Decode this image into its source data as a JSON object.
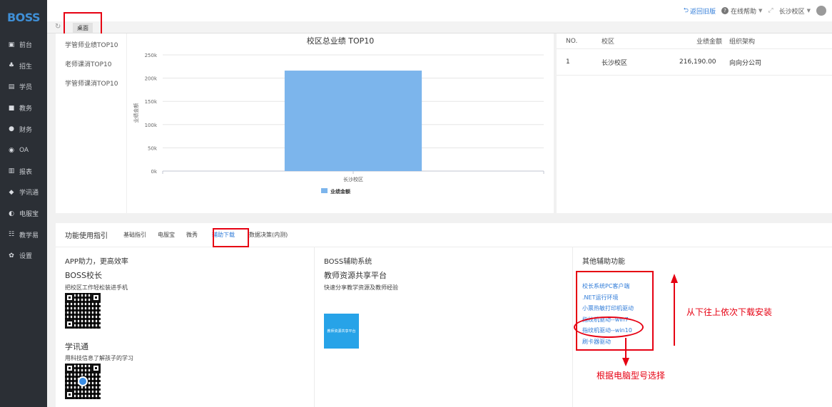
{
  "sidebar": {
    "logo": "BOSS",
    "items": [
      {
        "label": "前台",
        "icon": "calendar-icon"
      },
      {
        "label": "招生",
        "icon": "users-icon"
      },
      {
        "label": "学员",
        "icon": "id-card-icon"
      },
      {
        "label": "教务",
        "icon": "book-icon"
      },
      {
        "label": "财务",
        "icon": "money-icon"
      },
      {
        "label": "OA",
        "icon": "chat-icon"
      },
      {
        "label": "报表",
        "icon": "bar-chart-icon"
      },
      {
        "label": "学讯通",
        "icon": "location-icon"
      },
      {
        "label": "电服宝",
        "icon": "phone-icon"
      },
      {
        "label": "教学易",
        "icon": "teach-icon"
      },
      {
        "label": "设置",
        "icon": "gear-icon"
      }
    ]
  },
  "header": {
    "back_label": "返回旧版",
    "help_label": "在线帮助",
    "campus_label": "长沙校区"
  },
  "tabbar": {
    "desk_tab": "桌面"
  },
  "side_links": [
    "学管师业绩TOP10",
    "老师课消TOP10",
    "学管师课消TOP10"
  ],
  "chart_data": {
    "type": "bar",
    "title": "校区总业绩 TOP10",
    "categories": [
      "长沙校区"
    ],
    "series": [
      {
        "name": "业绩金额",
        "values": [
          216190
        ]
      }
    ],
    "ylabel": "业绩金额",
    "yticks": [
      "0k",
      "50k",
      "100k",
      "150k",
      "200k",
      "250k"
    ],
    "ylim": [
      0,
      250000
    ],
    "grid": true,
    "legend": "bottom",
    "bar_color": "#7cb5ec"
  },
  "table": {
    "headers": [
      "NO.",
      "校区",
      "业绩金额",
      "组织架构"
    ],
    "rows": [
      [
        "1",
        "长沙校区",
        "216,190.00",
        "向向分公司"
      ]
    ]
  },
  "guide": {
    "title": "功能使用指引",
    "tabs": [
      "基础指引",
      "电服宝",
      "微秀",
      "辅助下载",
      "数据决策(内测)"
    ],
    "active_tab": "辅助下载"
  },
  "col1": {
    "title": "APP助力，更高效率",
    "app1_name": "BOSS校长",
    "app1_desc": "把校区工作轻松装进手机",
    "app2_name": "学讯通",
    "app2_desc": "用科技信息了解孩子的学习"
  },
  "col2": {
    "title": "BOSS辅助系统",
    "name": "教师资源共享平台",
    "desc": "快速分享教学资源及教师经验",
    "img_text": "教师资源共享平台"
  },
  "col3": {
    "title": "其他辅助功能",
    "links": [
      "校长系统PC客户端",
      ".NET运行环境",
      "小票热敏打印机驱动",
      "指纹机驱动--win7",
      "指纹机驱动--win10",
      "刷卡器驱动"
    ]
  },
  "annotations": {
    "up_note": "从下往上依次下载安装",
    "select_note": "根据电脑型号选择"
  },
  "colors": {
    "accent": "#2f7bd8",
    "annotation": "#e60012",
    "sidebar": "#2b2f35"
  }
}
